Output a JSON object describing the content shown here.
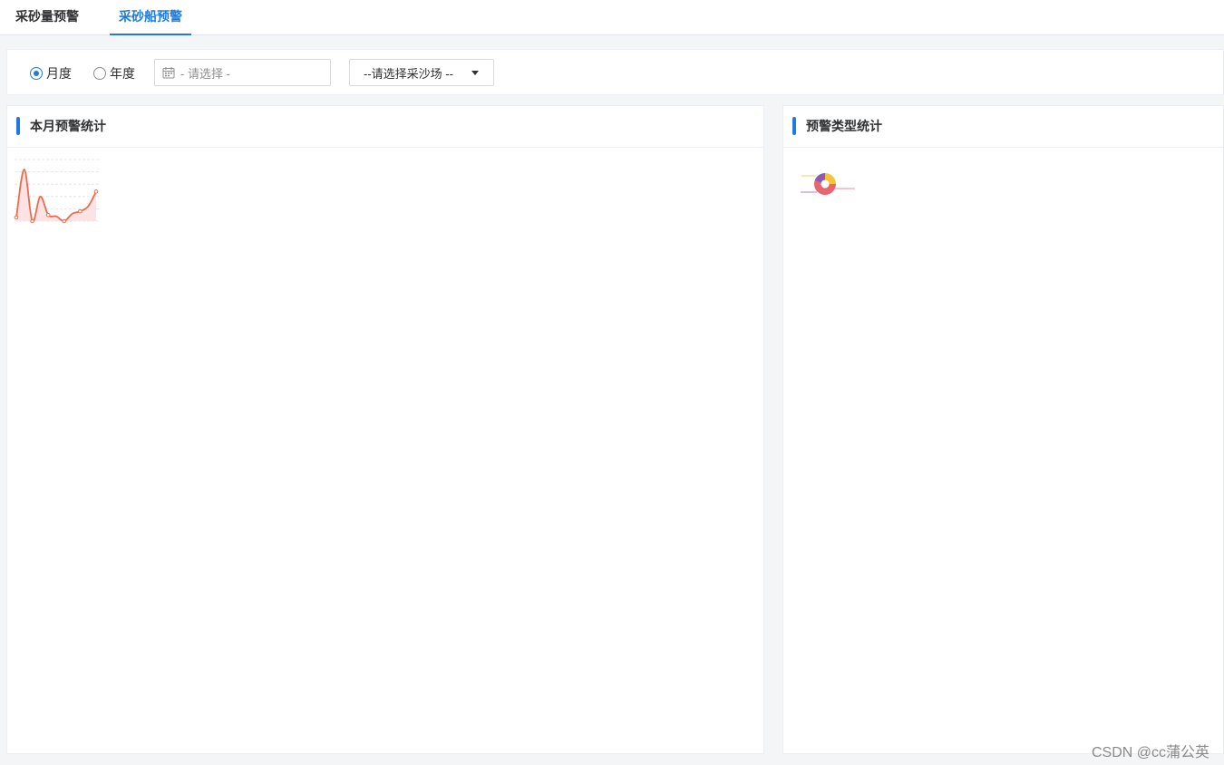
{
  "tabs": [
    {
      "label": "采砂量预警",
      "active": false
    },
    {
      "label": "采砂船预警",
      "active": true
    }
  ],
  "filters": {
    "period_options": [
      {
        "label": "月度",
        "checked": true
      },
      {
        "label": "年度",
        "checked": false
      }
    ],
    "date_placeholder": "- 请选择 -",
    "site_select": "--请选择采沙场 --"
  },
  "panels": {
    "left_title": "本月预警统计",
    "right_title": "预警类型统计"
  },
  "colors": {
    "accent": "#1f7ae0",
    "line": "#f06a4a",
    "area": "#fde2e6",
    "pie": [
      "#f5c33b",
      "#e86470",
      "#8e5bb4"
    ]
  },
  "chart_data": [
    {
      "type": "area",
      "x": [
        1,
        2,
        3,
        4,
        5,
        6,
        7,
        8,
        9,
        10,
        11
      ],
      "values": [
        3,
        42,
        0,
        20,
        5,
        4,
        0,
        6,
        8,
        12,
        24
      ],
      "ylim": [
        0,
        50
      ],
      "grid": true
    },
    {
      "type": "pie",
      "style": "donut",
      "values": [
        25,
        55,
        20
      ]
    }
  ],
  "watermark": "CSDN @cc蒲公英"
}
